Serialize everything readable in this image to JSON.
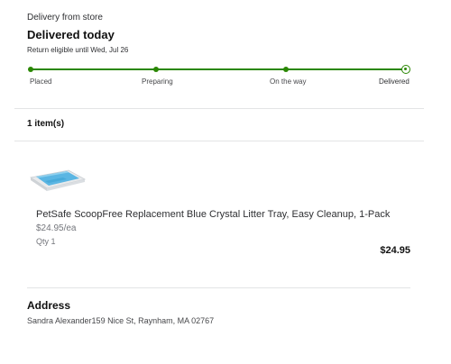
{
  "order": {
    "delivery_type": "Delivery from store",
    "status_title": "Delivered today",
    "return_note": "Return eligible until Wed, Jul 26"
  },
  "progress": {
    "stages": [
      "Placed",
      "Preparing",
      "On the way",
      "Delivered"
    ],
    "current_stage": "Delivered",
    "accent_color": "#2a8703"
  },
  "items": {
    "count_label": "1 item(s)",
    "list": [
      {
        "name": "PetSafe ScoopFree Replacement Blue Crystal Litter Tray, Easy Cleanup, 1-Pack",
        "unit_price": "$24.95/ea",
        "qty": "Qty 1",
        "total": "$24.95",
        "image_icon": "litter-tray-image"
      }
    ]
  },
  "address": {
    "title": "Address",
    "text": "Sandra Alexander159 Nice St, Raynham, MA 02767"
  }
}
